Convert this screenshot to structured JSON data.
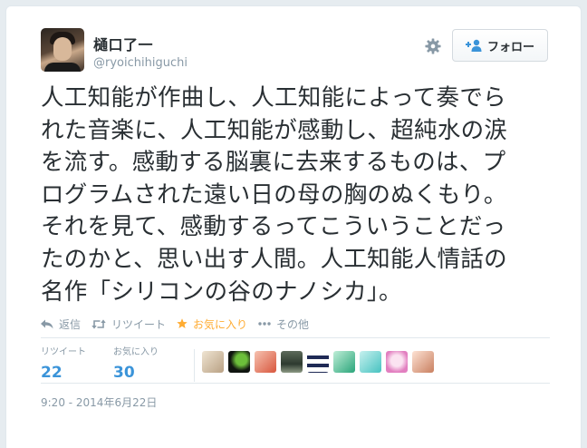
{
  "tweet": {
    "user": {
      "display_name": "樋口了一",
      "handle": "@ryoichihiguchi"
    },
    "follow_label": "フォロー",
    "text": "人工知能が作曲し、人工知能によって奏でら\nれた音楽に、人工知能が感動し、超純水の涙\nを流す。感動する脳裏に去来するものは、プ\nログラムされた遠い日の母の胸のぬくもり。\nそれを見て、感動するってこういうことだっ\nたのかと、思い出す人間。人工知能人情話の\n名作「シリコンの谷のナノシカ」。",
    "actions": {
      "reply": "返信",
      "retweet": "リツイート",
      "favorite": "お気に入り",
      "more": "その他"
    },
    "stats": {
      "retweets_label": "リツイート",
      "retweets_count": "22",
      "favorites_label": "お気に入り",
      "favorites_count": "30"
    },
    "timestamp": "9:20 - 2014年6月22日"
  },
  "colors": {
    "link_blue": "#3b94d9",
    "favorite_gold": "#ffac33",
    "muted_gray": "#8899a6",
    "text_dark": "#292f33"
  }
}
